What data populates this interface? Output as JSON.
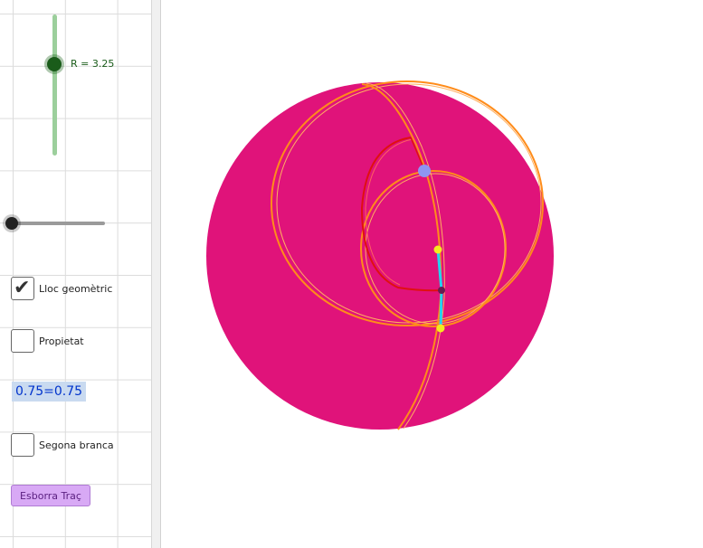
{
  "slider_r": {
    "label": "R = 3.25",
    "value": 3.25
  },
  "slider_2": {
    "value": 0
  },
  "checkboxes": [
    {
      "label": "Lloc geomètric",
      "checked": true
    },
    {
      "label": "Propietat",
      "checked": false
    },
    {
      "label": "Segona branca",
      "checked": false
    }
  ],
  "equality_text": "0.75=0.75",
  "erase_button": {
    "label": "Esborra Traç"
  },
  "colors": {
    "sphere": "#e0137a",
    "circles": "#ff8c1a",
    "locus": "#e01010",
    "segment": "#22d4f0",
    "point_main": "#8e94f2",
    "point_yellow": "#f4ea20",
    "point_dark": "#6a1a50"
  }
}
